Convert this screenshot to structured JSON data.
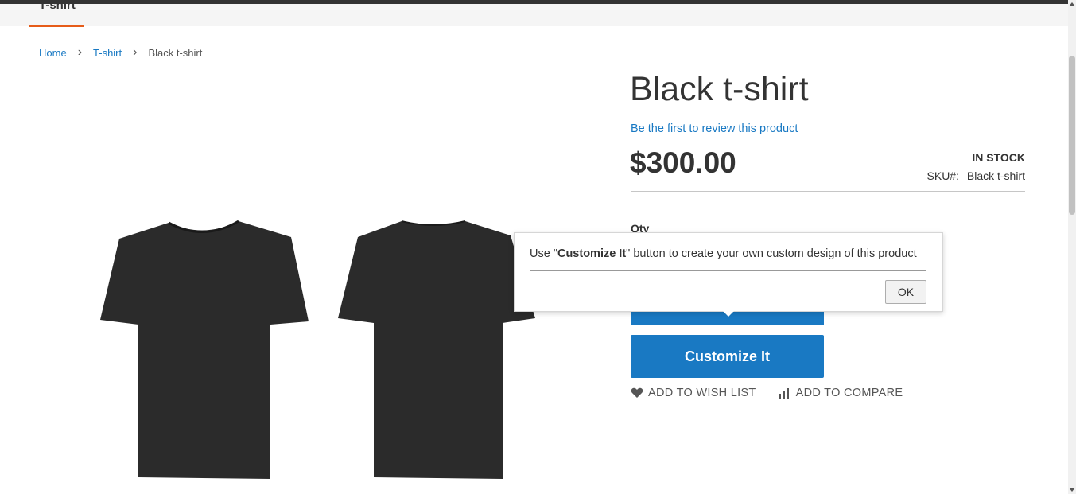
{
  "nav": {
    "active_item": "T-shirt"
  },
  "breadcrumbs": {
    "home": "Home",
    "category": "T-shirt",
    "current": "Black t-shirt"
  },
  "product": {
    "name": "Black t-shirt",
    "review_link": "Be the first to review this product",
    "price": "$300.00",
    "stock": "IN STOCK",
    "sku_label": "SKU#:",
    "sku_value": "Black t-shirt",
    "qty_label": "Qty"
  },
  "buttons": {
    "customize": "Customize It"
  },
  "actions": {
    "wishlist": "Add to Wish List",
    "compare": "Add to Compare"
  },
  "popup": {
    "message_prefix": "Use \"",
    "message_bold": "Customize It",
    "message_suffix": "\" button to create your own custom design of this product",
    "ok_label": "OK"
  },
  "colors": {
    "accent": "#1979c3",
    "nav_underline": "#e65c19",
    "shirt": "#2b2b2b"
  },
  "icons": {
    "wishlist": "heart-icon",
    "compare": "bar-chart-icon"
  }
}
